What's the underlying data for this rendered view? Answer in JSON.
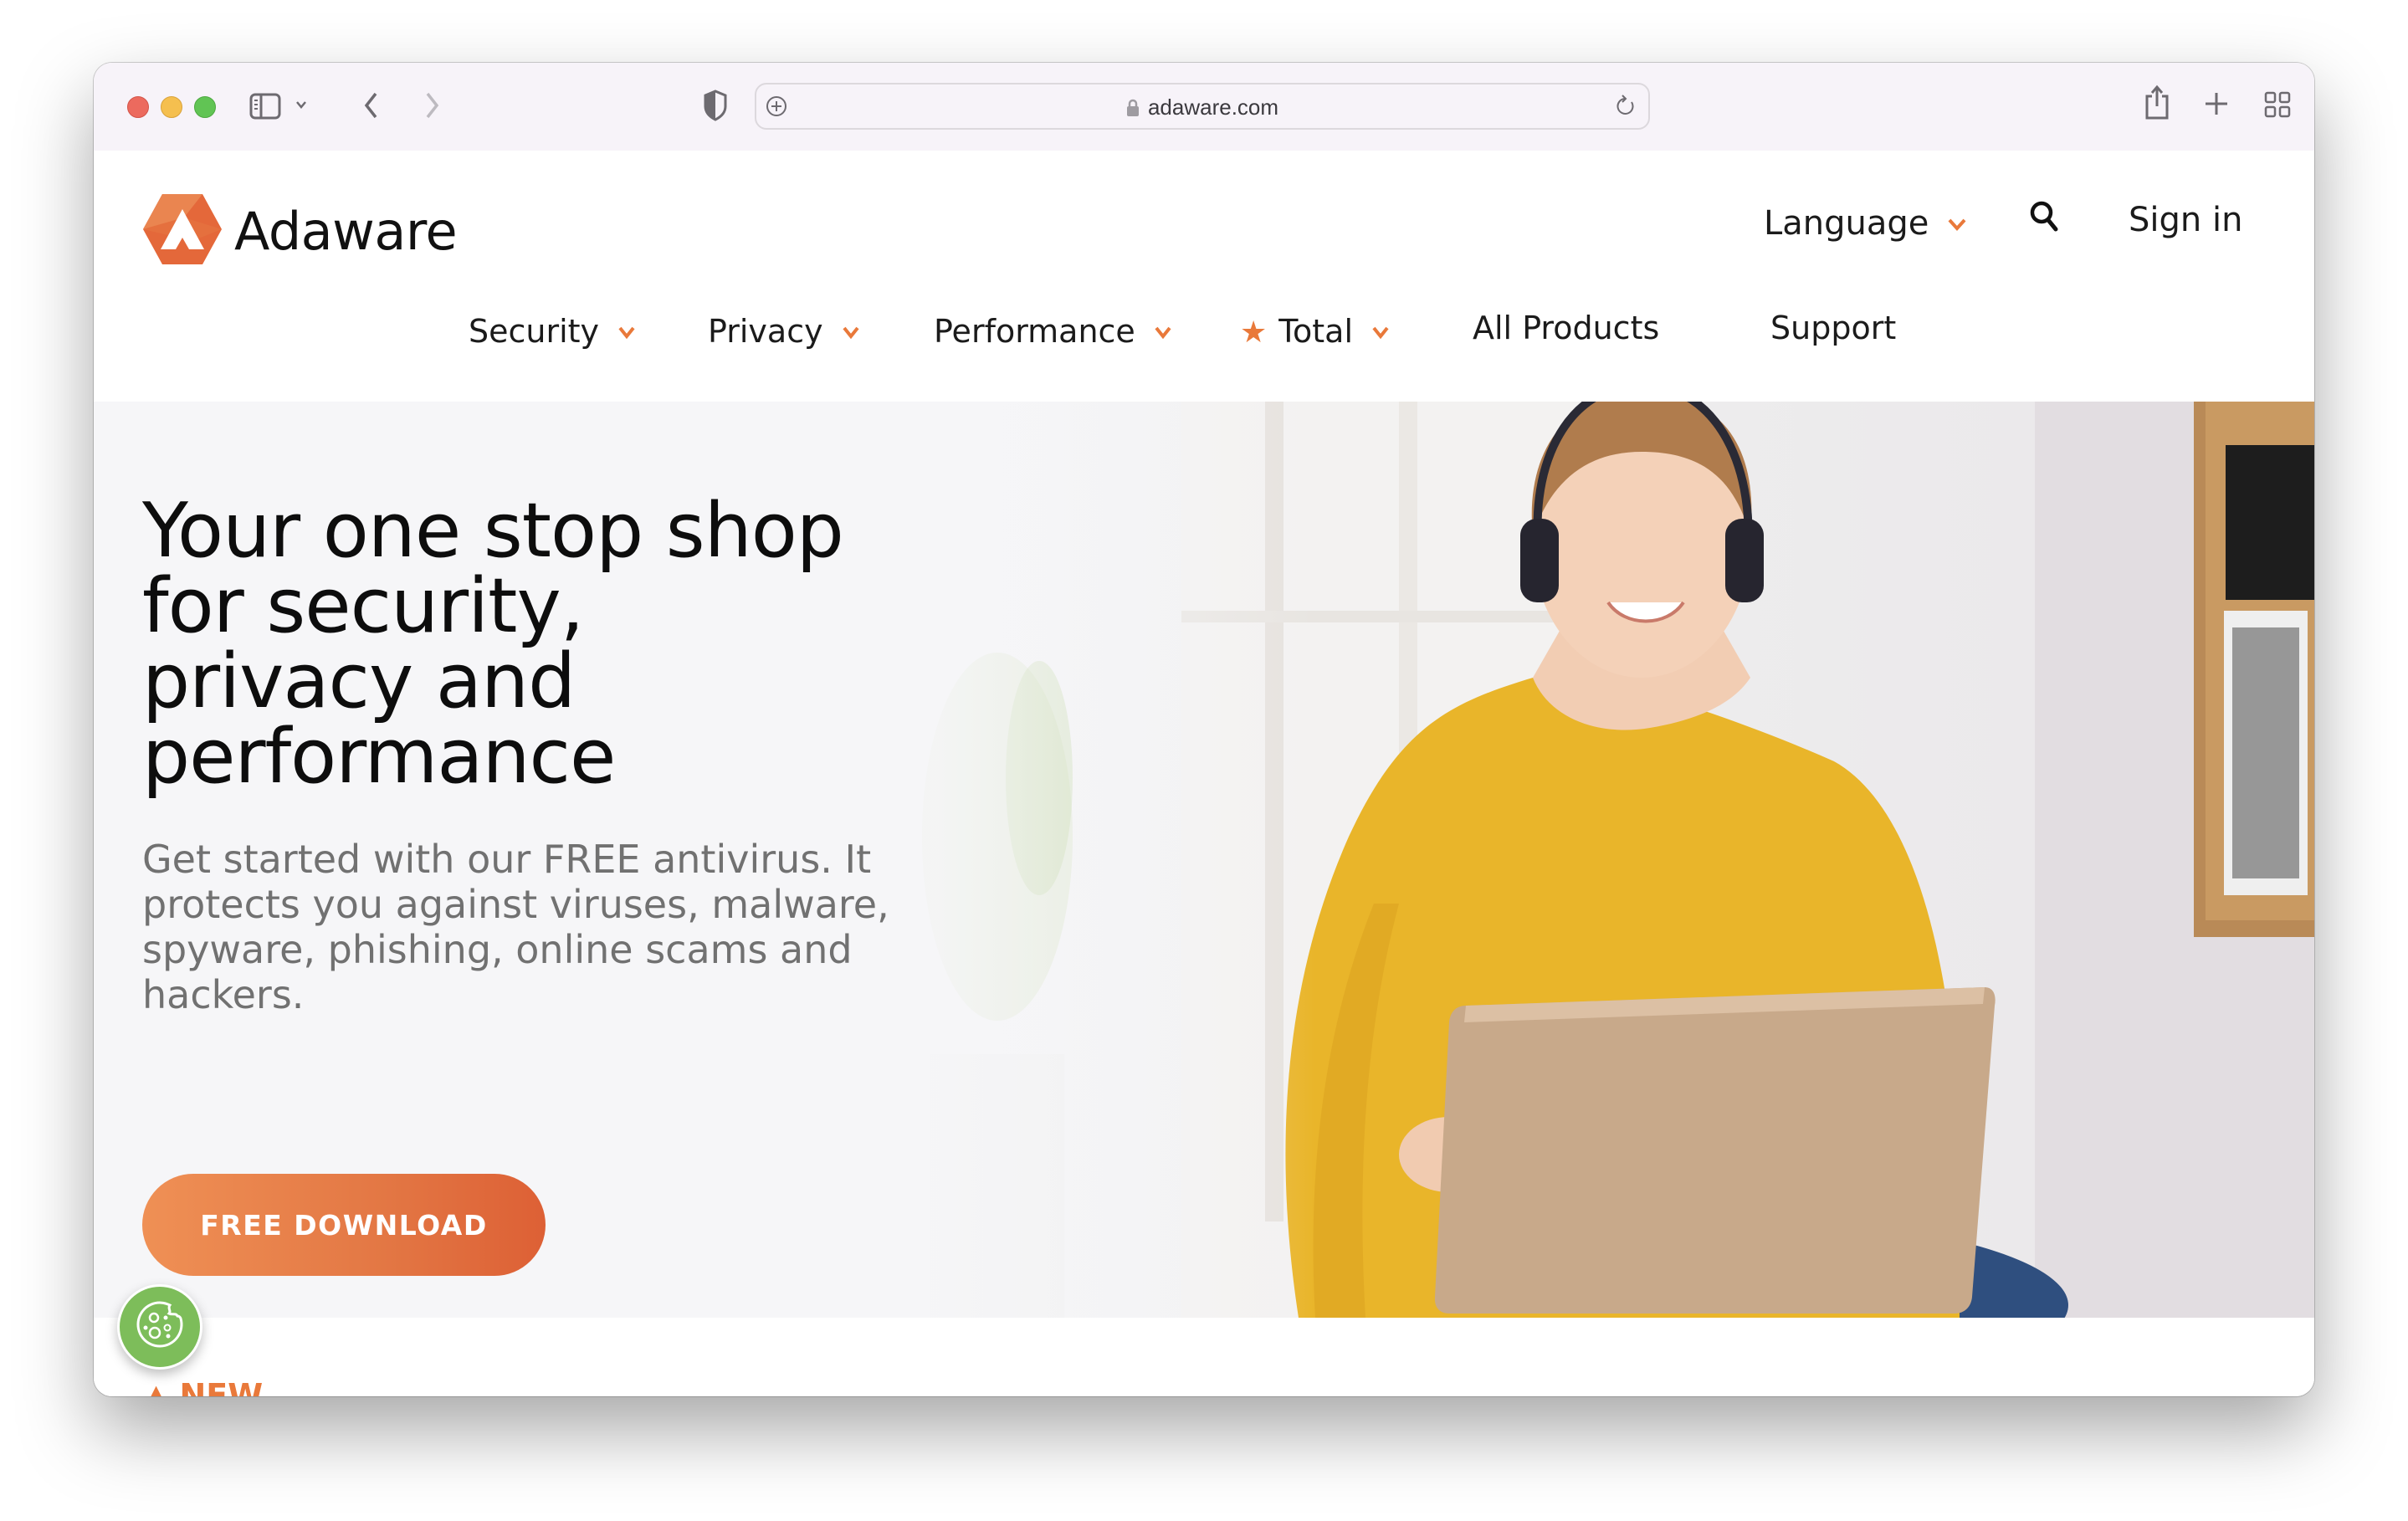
{
  "browser": {
    "url": "adaware.com",
    "icons": {
      "sidebar": "sidebar-icon",
      "tab_overview_menu": "chevron-down-icon",
      "back": "chevron-left-icon",
      "forward": "chevron-right-icon",
      "privacy": "shield-icon",
      "site_settings": "plus-circle-icon",
      "lock": "lock-icon",
      "reload": "reload-icon",
      "share": "share-icon",
      "new_tab": "plus-icon",
      "tab_overview": "grid-icon"
    }
  },
  "header": {
    "brand": "Adaware",
    "brand_color": "#e4683a",
    "language_label": "Language",
    "search_icon": "search-icon",
    "signin_label": "Sign in"
  },
  "nav": {
    "items": [
      {
        "label": "Security",
        "has_dropdown": true
      },
      {
        "label": "Privacy",
        "has_dropdown": true
      },
      {
        "label": "Performance",
        "has_dropdown": true
      },
      {
        "label": "Total",
        "has_dropdown": true,
        "starred": true
      },
      {
        "label": "All Products",
        "has_dropdown": false
      },
      {
        "label": "Support",
        "has_dropdown": false
      }
    ],
    "accent": "#e9793a"
  },
  "hero": {
    "headline_lines": [
      "Your one stop shop",
      "for security,",
      "privacy and",
      "performance"
    ],
    "subtext": "Get started with our FREE antivirus. It protects you against viruses, malware, spyware, phishing, online scams and hackers.",
    "cta_label": "FREE DOWNLOAD"
  },
  "below_fold": {
    "badge_label": "NEW"
  },
  "cookie_button": {
    "icon": "cookie-icon",
    "color": "#7dbd5a"
  }
}
